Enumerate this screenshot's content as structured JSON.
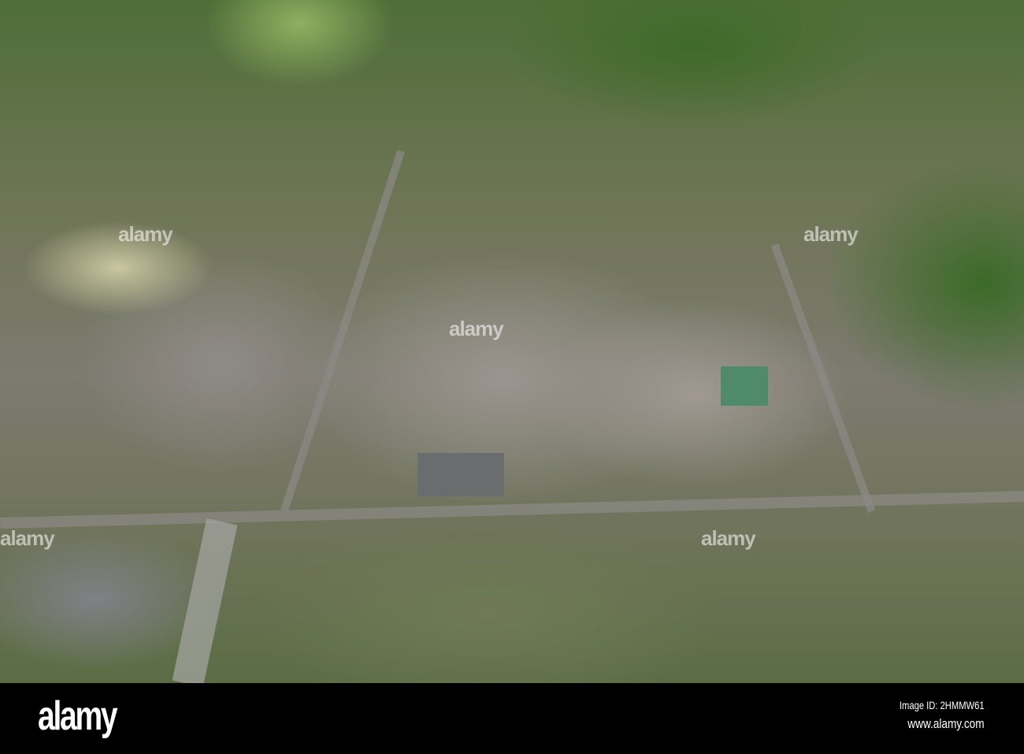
{
  "photo": {
    "description_alt": "aerial city view"
  },
  "watermark": {
    "text": "alamy"
  },
  "footer": {
    "logo": "alamy",
    "image_id": "Image ID: 2HMMW61",
    "url": "www.alamy.com"
  }
}
